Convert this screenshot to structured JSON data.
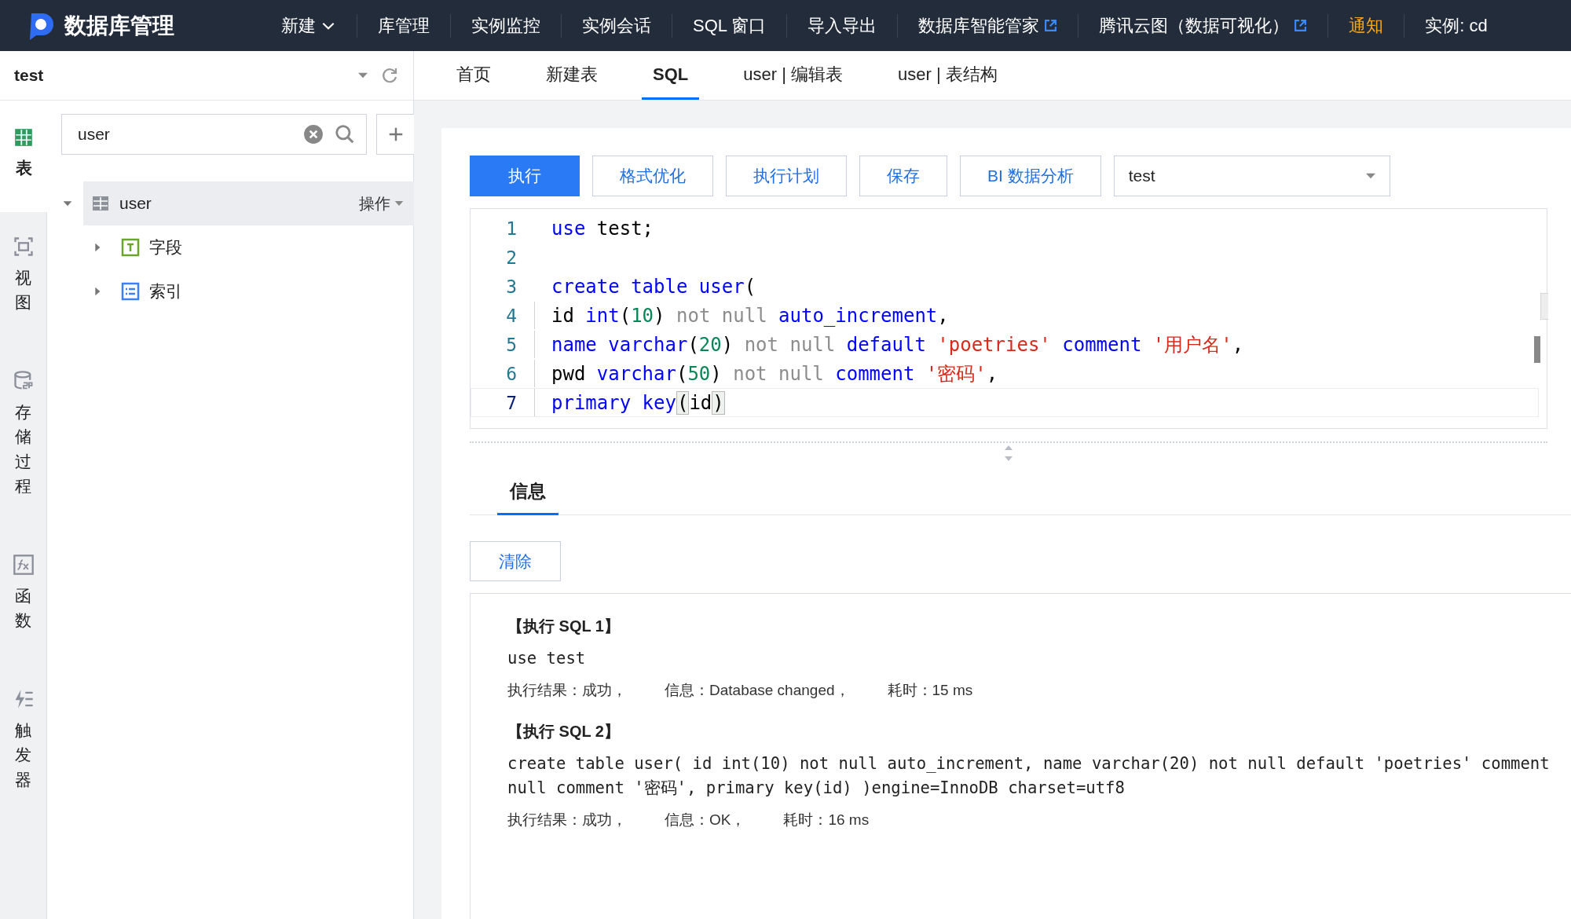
{
  "topbar": {
    "title": "数据库管理",
    "menu": [
      {
        "label": "新建",
        "kind": "dropdown"
      },
      {
        "label": "库管理",
        "kind": "plain"
      },
      {
        "label": "实例监控",
        "kind": "plain"
      },
      {
        "label": "实例会话",
        "kind": "plain"
      },
      {
        "label": "SQL 窗口",
        "kind": "plain"
      },
      {
        "label": "导入导出",
        "kind": "plain"
      },
      {
        "label": "数据库智能管家",
        "kind": "external"
      },
      {
        "label": "腾讯云图（数据可视化）",
        "kind": "external"
      },
      {
        "label": "通知",
        "kind": "notice"
      },
      {
        "label": "实例: cd",
        "kind": "plain"
      }
    ]
  },
  "database": {
    "value": "test"
  },
  "rail": [
    {
      "label": "表",
      "kind": "table",
      "selected": true
    },
    {
      "label": "视图",
      "kind": "view",
      "selected": false
    },
    {
      "label": "存储过程",
      "kind": "procedure",
      "selected": false
    },
    {
      "label": "函数",
      "kind": "function",
      "selected": false
    },
    {
      "label": "触发器",
      "kind": "trigger",
      "selected": false
    }
  ],
  "search": {
    "value": "user"
  },
  "tree": [
    {
      "label": "user",
      "action": "操作",
      "expanded": true,
      "selected": true,
      "children": [
        {
          "label": "字段",
          "kind": "field",
          "expanded": false,
          "selected": false
        },
        {
          "label": "索引",
          "kind": "index",
          "expanded": false,
          "selected": false
        }
      ]
    }
  ],
  "tabs": [
    {
      "label": "首页",
      "selected": false
    },
    {
      "label": "新建表",
      "selected": false
    },
    {
      "label": "SQL",
      "selected": true
    },
    {
      "label": "user | 编辑表",
      "selected": false
    },
    {
      "label": "user | 表结构",
      "selected": false
    }
  ],
  "toolbar": {
    "buttons": [
      {
        "label": "执行",
        "primary": true
      },
      {
        "label": "格式优化",
        "primary": false
      },
      {
        "label": "执行计划",
        "primary": false
      },
      {
        "label": "保存",
        "primary": false
      },
      {
        "label": "BI 数据分析",
        "primary": false
      }
    ],
    "database_select": "test"
  },
  "editor": {
    "lines": [
      {
        "number": "1",
        "indented": false,
        "active": false,
        "tokens": [
          {
            "kind": "keyword",
            "t": "use"
          },
          {
            "kind": "plain",
            "t": " test;"
          }
        ]
      },
      {
        "number": "2",
        "indented": false,
        "active": false
      },
      {
        "number": "3",
        "indented": false,
        "active": false,
        "tokens": [
          {
            "kind": "keyword",
            "t": "create table user"
          },
          {
            "kind": "plain",
            "t": "("
          }
        ]
      },
      {
        "number": "4",
        "indented": true,
        "active": false,
        "tokens": [
          {
            "kind": "plain",
            "t": "id "
          },
          {
            "kind": "keyword",
            "t": "int"
          },
          {
            "kind": "plain",
            "t": "("
          },
          {
            "kind": "number",
            "t": "10"
          },
          {
            "kind": "plain",
            "t": ") "
          },
          {
            "kind": "muted",
            "t": "not null "
          },
          {
            "kind": "keyword",
            "t": "auto_increment"
          },
          {
            "kind": "plain",
            "t": ","
          }
        ]
      },
      {
        "number": "5",
        "indented": true,
        "active": false,
        "tokens": [
          {
            "kind": "keyword",
            "t": "name varchar"
          },
          {
            "kind": "plain",
            "t": "("
          },
          {
            "kind": "number",
            "t": "20"
          },
          {
            "kind": "plain",
            "t": ") "
          },
          {
            "kind": "muted",
            "t": "not null "
          },
          {
            "kind": "keyword",
            "t": "default "
          },
          {
            "kind": "string",
            "t": "'poetries' "
          },
          {
            "kind": "keyword",
            "t": "comment "
          },
          {
            "kind": "string",
            "t": "'用户名'"
          },
          {
            "kind": "plain",
            "t": ","
          }
        ]
      },
      {
        "number": "6",
        "indented": true,
        "active": false,
        "tokens": [
          {
            "kind": "plain",
            "t": "pwd "
          },
          {
            "kind": "keyword",
            "t": "varchar"
          },
          {
            "kind": "plain",
            "t": "("
          },
          {
            "kind": "number",
            "t": "50"
          },
          {
            "kind": "plain",
            "t": ") "
          },
          {
            "kind": "muted",
            "t": "not null "
          },
          {
            "kind": "keyword",
            "t": "comment "
          },
          {
            "kind": "string",
            "t": "'密码'"
          },
          {
            "kind": "plain",
            "t": ","
          }
        ]
      },
      {
        "number": "7",
        "indented": true,
        "active": true,
        "tokens": [
          {
            "kind": "keyword",
            "t": "primary key"
          },
          {
            "kind": "bracket",
            "t": "("
          },
          {
            "kind": "plain",
            "t": "id"
          },
          {
            "kind": "bracket",
            "t": ")"
          }
        ]
      }
    ]
  },
  "output_tabs": [
    {
      "label": "信息",
      "selected": true
    }
  ],
  "clear_button": "清除",
  "results": [
    {
      "title": "【执行 SQL 1】",
      "sql": [
        "use test"
      ],
      "status": [
        "执行结果：成功，",
        "信息：Database changed，",
        "耗时：15 ms"
      ]
    },
    {
      "title": "【执行 SQL 2】",
      "sql": [
        "create table user( id int(10) not null auto_increment, name varchar(20) not null default 'poetries' comment",
        "null comment '密码', primary key(id) )engine=InnoDB charset=utf8"
      ],
      "status": [
        "执行结果：成功，",
        "信息：OK，",
        "耗时：16 ms"
      ]
    }
  ]
}
